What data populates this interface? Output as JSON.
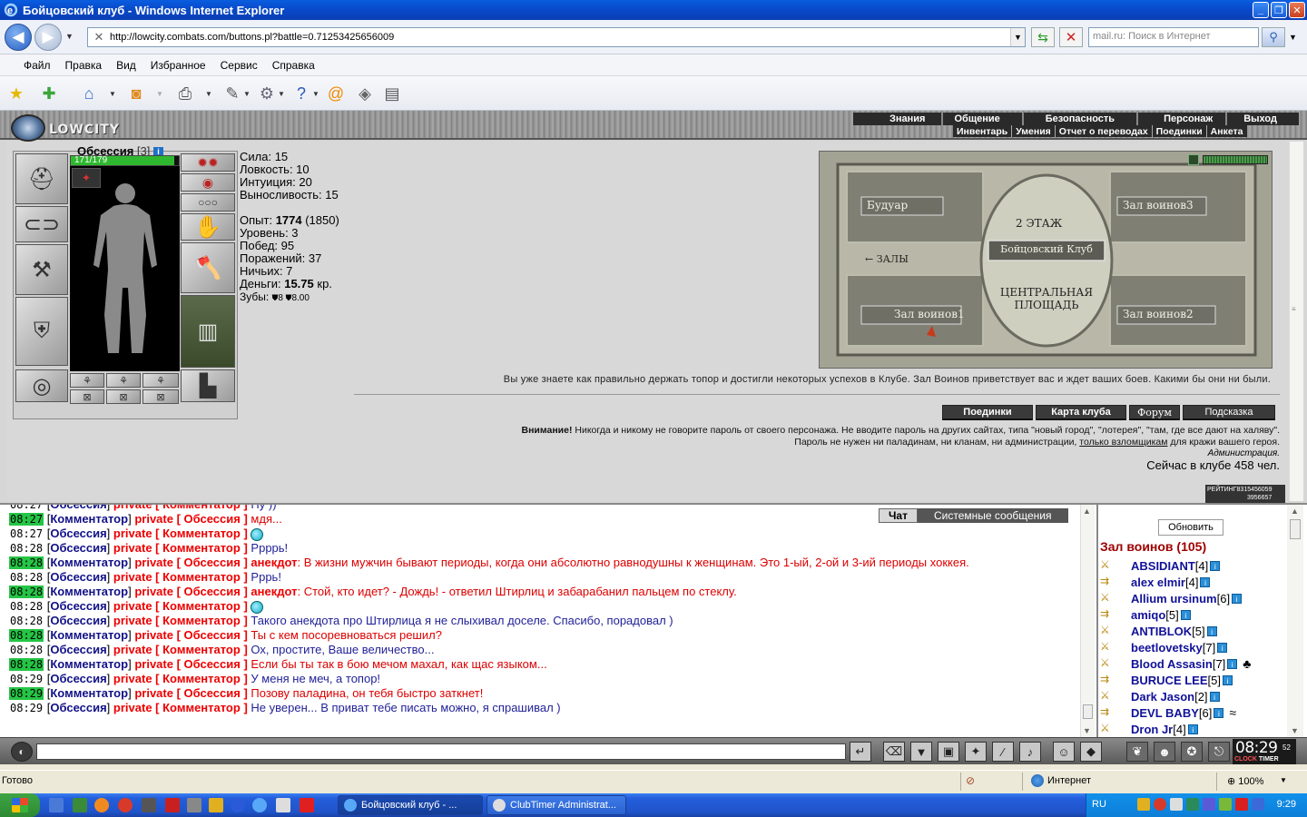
{
  "window": {
    "title": "Бойцовский клуб - Windows Internet Explorer"
  },
  "browser": {
    "url": "http://lowcity.combats.com/buttons.pl?battle=0.71253425656009",
    "search_placeholder": "mail.ru: Поиск в Интернет",
    "menu": [
      "Файл",
      "Правка",
      "Вид",
      "Избранное",
      "Сервис",
      "Справка"
    ],
    "status": "Готово",
    "zone": "Интернет",
    "zoom": "100%"
  },
  "game": {
    "logo": "LOWCITY",
    "nav_top": [
      "Знания",
      "Общение",
      "Безопасность",
      "Персонаж",
      "Выход"
    ],
    "nav_sub": [
      "Инвентарь",
      "Умения",
      "Отчет о переводах",
      "Поединки",
      "Анкета"
    ],
    "character": {
      "name": "Обсессия",
      "level": "[3]",
      "hp": "171/179",
      "hp_fraction": 0.955
    },
    "stats": {
      "strength": "Сила: 15",
      "agility": "Ловкость: 10",
      "intuition": "Интуиция: 20",
      "endurance": "Выносливость: 15",
      "exp_label": "Опыт: ",
      "exp_value": "1774",
      "exp_next": " (1850)",
      "level": "Уровень: 3",
      "wins": "Побед: 95",
      "losses": "Поражений: 37",
      "draws": "Ничьих: 7",
      "money_label": "Деньги: ",
      "money_value": "15.75",
      "money_unit": " кр.",
      "teeth_label": "Зубы: ",
      "teeth_value": "8 ",
      "teeth_value2": "8.00"
    },
    "map": {
      "floor": "2 ЭТАЖ",
      "rooms": {
        "boudoir": "Будуар",
        "hall3": "Зал воинов3",
        "club": "Бойцовский Клуб",
        "halls": "← ЗАЛЫ",
        "square": "ЦЕНТРАЛЬНАЯ ПЛОЩАДЬ",
        "hall1": "Зал воинов1",
        "hall2": "Зал воинов2"
      }
    },
    "welcome": "Вы уже знаете как правильно держать топор и достигли некоторых успехов в Клубе. Зал Воинов приветствует вас и ждет ваших боев. Какими бы они ни были.",
    "buttons": {
      "duels": "Поединки",
      "club_map": "Карта клуба",
      "forum": "Форум",
      "hint": "Подсказка"
    },
    "warning": {
      "bold": "Внимание!",
      "line1": " Никогда и никому не говорите пароль от своего персонажа. Не вводите пароль на других сайтах, типа \"новый город\", \"лотерея\", \"там, где все дают на халяву\".",
      "line2a": "Пароль не нужен ни паладинам, ни кланам, ни администрации, ",
      "line2u": "только взломщикам",
      "line2b": " для кражи вашего героя.",
      "admin": "Администрация."
    },
    "online": "Сейчас в клубе 458 чел.",
    "rating": {
      "label": "РЕЙТИНГ",
      "value1": "8315456059",
      "value2": "3956657"
    }
  },
  "chat": {
    "tabs": {
      "chat": "Чат",
      "system": "Системные сообщения"
    },
    "sender_open": "[",
    "sender_close": "]",
    "private_open": "private [",
    "private_close": "]",
    "messages": [
      {
        "time": "08:27",
        "hl": true,
        "sender": "Комментатор",
        "to": "Обсессия",
        "text": "мдя...",
        "cls": "tx-red"
      },
      {
        "time": "08:27",
        "hl": false,
        "sender": "Обсессия",
        "to": "Комментатор",
        "text": "",
        "smiley": true,
        "cls": "tx-blue"
      },
      {
        "time": "08:28",
        "hl": false,
        "sender": "Обсессия",
        "to": "Комментатор",
        "text": "Ррррь!",
        "cls": "tx-blue"
      },
      {
        "time": "08:28",
        "hl": true,
        "sender": "Комментатор",
        "to": "Обсессия",
        "prefix": "анекдот",
        "text": ": В жизни мужчин бывают периоды, когда они абсолютно равнодушны к женщинам. Это 1-ый, 2-ой и 3-ий периоды хоккея.",
        "cls": "tx-red"
      },
      {
        "time": "08:28",
        "hl": false,
        "sender": "Обсессия",
        "to": "Комментатор",
        "text": "Рррь!",
        "cls": "tx-blue"
      },
      {
        "time": "08:28",
        "hl": true,
        "sender": "Комментатор",
        "to": "Обсессия",
        "prefix": "анекдот",
        "text": ": Стой, кто идет? - Дождь! - ответил Штирлиц и забарабанил пальцем по стеклу.",
        "cls": "tx-red"
      },
      {
        "time": "08:28",
        "hl": false,
        "sender": "Обсессия",
        "to": "Комментатор",
        "text": "",
        "smiley": true,
        "cls": "tx-blue"
      },
      {
        "time": "08:28",
        "hl": false,
        "sender": "Обсессия",
        "to": "Комментатор",
        "text": "Такого анекдота про Штирлица я не слыхивал доселе. Спасибо, порадовал )",
        "cls": "tx-blue"
      },
      {
        "time": "08:28",
        "hl": true,
        "sender": "Комментатор",
        "to": "Обсессия",
        "text": "Ты с кем посоревноваться решил?",
        "cls": "tx-red"
      },
      {
        "time": "08:28",
        "hl": false,
        "sender": "Обсессия",
        "to": "Комментатор",
        "text": "Ох, простите, Ваше величество...",
        "cls": "tx-blue"
      },
      {
        "time": "08:28",
        "hl": true,
        "sender": "Комментатор",
        "to": "Обсессия",
        "text": "Если бы ты так в бою мечом махал, как щас языком...",
        "cls": "tx-red"
      },
      {
        "time": "08:29",
        "hl": false,
        "sender": "Обсессия",
        "to": "Комментатор",
        "text": "У меня не меч, а топор!",
        "cls": "tx-blue"
      },
      {
        "time": "08:29",
        "hl": true,
        "sender": "Комментатор",
        "to": "Обсессия",
        "text": "Позову паладина, он тебя быстро заткнет!",
        "cls": "tx-red"
      },
      {
        "time": "08:29",
        "hl": false,
        "sender": "Обсессия",
        "to": "Комментатор",
        "text": "Не уверен... В приват тебе писать можно, я спрашивал )",
        "cls": "tx-blue"
      }
    ]
  },
  "players": {
    "refresh": "Обновить",
    "hall": "Зал воинов (105)",
    "list": [
      {
        "name": "ABSIDIANT",
        "lvl": "[4]"
      },
      {
        "name": "alex elmir",
        "lvl": "[4]"
      },
      {
        "name": "Allium ursinum",
        "lvl": "[6]"
      },
      {
        "name": "amiqo",
        "lvl": "[5]"
      },
      {
        "name": "ANTIBLOK",
        "lvl": "[5]"
      },
      {
        "name": "beetlovetsky",
        "lvl": "[7]"
      },
      {
        "name": "Blood Assasin",
        "lvl": "[7]",
        "extra": "♣"
      },
      {
        "name": "BURUCE LEE",
        "lvl": "[5]"
      },
      {
        "name": "Dark Jason",
        "lvl": "[2]"
      },
      {
        "name": "DEVL BABY",
        "lvl": "[6]",
        "extra": "≈"
      },
      {
        "name": "Dron Jr",
        "lvl": "[4]"
      }
    ]
  },
  "clock": {
    "time": "08:29",
    "seconds": "52",
    "label1": "CLOCK",
    "label2": "TIMER"
  },
  "taskbar": {
    "tasks": [
      "Бойцовский клуб - ...",
      "ClubTimer Administrat..."
    ],
    "lang": "RU",
    "time": "9:29"
  }
}
